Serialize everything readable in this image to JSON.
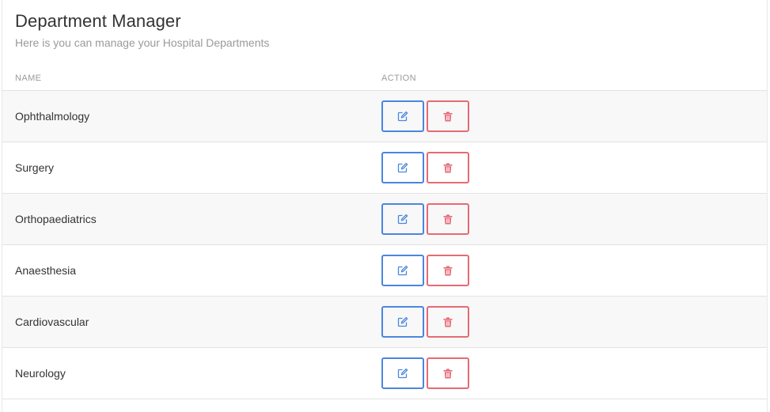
{
  "header": {
    "title": "Department Manager",
    "subtitle": "Here is you can manage your Hospital Departments"
  },
  "table": {
    "columns": [
      "NAME",
      "ACTION"
    ],
    "rows": [
      {
        "name": "Ophthalmology"
      },
      {
        "name": "Surgery"
      },
      {
        "name": "Orthopaediatrics"
      },
      {
        "name": "Anaesthesia"
      },
      {
        "name": "Cardiovascular"
      },
      {
        "name": "Neurology"
      }
    ]
  },
  "icons": {
    "edit": "edit-icon",
    "delete": "trash-icon"
  },
  "colors": {
    "edit_accent": "#4a86e0",
    "delete_accent": "#e66a74"
  }
}
